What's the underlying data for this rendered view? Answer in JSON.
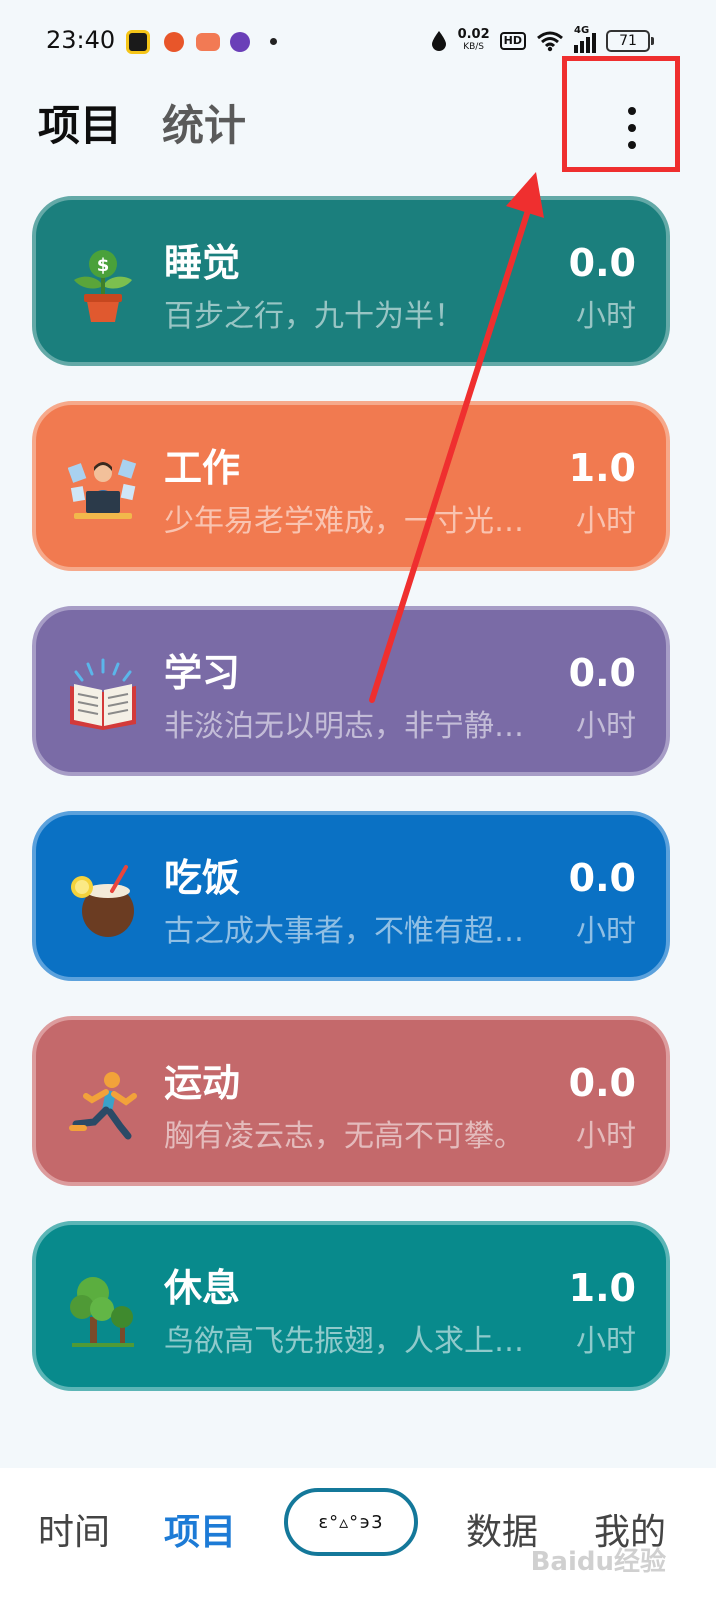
{
  "status_bar": {
    "time": "23:40",
    "net_speed": "0.02",
    "net_unit": "KB/S",
    "hd": "HD",
    "signal": "4G",
    "battery": "71"
  },
  "header": {
    "tabs": [
      {
        "label": "项目",
        "active": true
      },
      {
        "label": "统计",
        "active": false
      }
    ],
    "more_icon": "more-vertical-icon"
  },
  "projects": [
    {
      "icon": "money-plant-icon",
      "title": "睡觉",
      "motto": "百步之行，九十为半！",
      "value": "0.0",
      "unit": "小时",
      "color": "#1b7f7d",
      "border": "#63a9a7"
    },
    {
      "icon": "office-worker-icon",
      "title": "工作",
      "motto": "少年易老学难成，一寸光…",
      "value": "1.0",
      "unit": "小时",
      "color": "#f17a50",
      "border": "#f6a98b"
    },
    {
      "icon": "open-book-icon",
      "title": "学习",
      "motto": "非淡泊无以明志，非宁静…",
      "value": "0.0",
      "unit": "小时",
      "color": "#7a6ba6",
      "border": "#a79dc6"
    },
    {
      "icon": "coconut-drink-icon",
      "title": "吃饭",
      "motto": "古之成大事者，不惟有超…",
      "value": "0.0",
      "unit": "小时",
      "color": "#0a71c4",
      "border": "#5ba1dc"
    },
    {
      "icon": "runner-icon",
      "title": "运动",
      "motto": "胸有凌云志，无高不可攀。",
      "value": "0.0",
      "unit": "小时",
      "color": "#c4696b",
      "border": "#dc9c9d"
    },
    {
      "icon": "tree-icon",
      "title": "休息",
      "motto": "鸟欲高飞先振翅，人求上…",
      "value": "1.0",
      "unit": "小时",
      "color": "#088a8c",
      "border": "#5bb5b6"
    }
  ],
  "bottom_nav": {
    "items": [
      {
        "label": "时间",
        "active": false
      },
      {
        "label": "项目",
        "active": true
      },
      {
        "label": "数据",
        "active": false
      },
      {
        "label": "我的",
        "active": false
      }
    ],
    "center_label": "ε°▵°϶3",
    "watermark": "Baidu经验"
  },
  "colors": {
    "accent": "#1d7bd6",
    "annotation": "#ef2f2f"
  }
}
